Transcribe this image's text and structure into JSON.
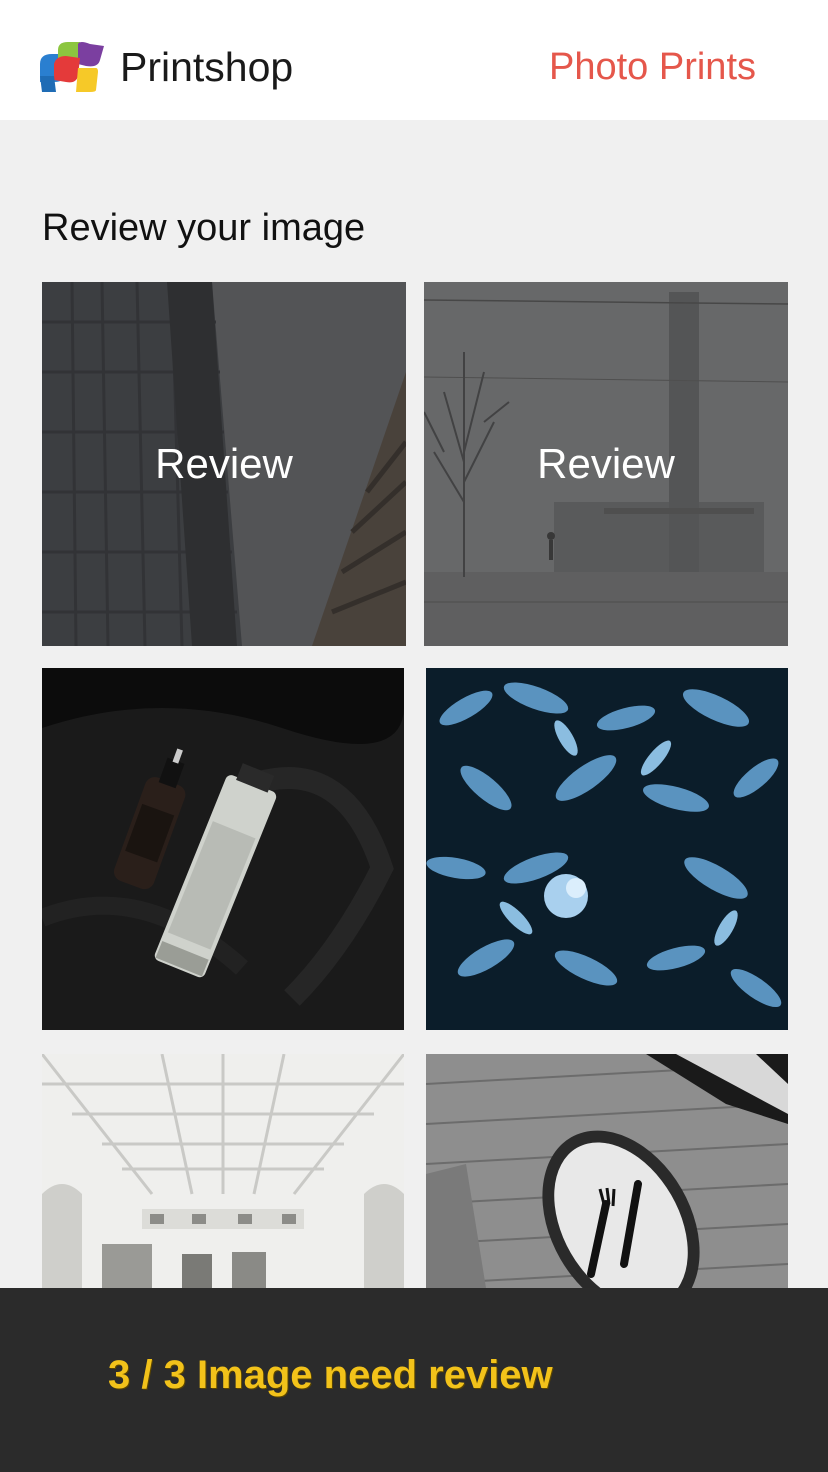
{
  "header": {
    "brand_name": "Printshop",
    "nav_link": "Photo Prints"
  },
  "main": {
    "title": "Review your image",
    "tiles": [
      {
        "name": "building-photo",
        "overlay_label": "Review",
        "needs_review": true
      },
      {
        "name": "street-tree-photo",
        "overlay_label": "Review",
        "needs_review": true
      },
      {
        "name": "aesop-products-photo",
        "needs_review": false
      },
      {
        "name": "blue-succulent-photo",
        "needs_review": false
      },
      {
        "name": "white-hall-interior-photo",
        "needs_review": false
      },
      {
        "name": "restaurant-sign-photo",
        "needs_review": false
      }
    ]
  },
  "footer": {
    "status": "3 / 3 Image need review"
  },
  "colors": {
    "accent": "#e5574b",
    "status": "#f2c21a",
    "footer_bg": "#2b2b2b"
  }
}
